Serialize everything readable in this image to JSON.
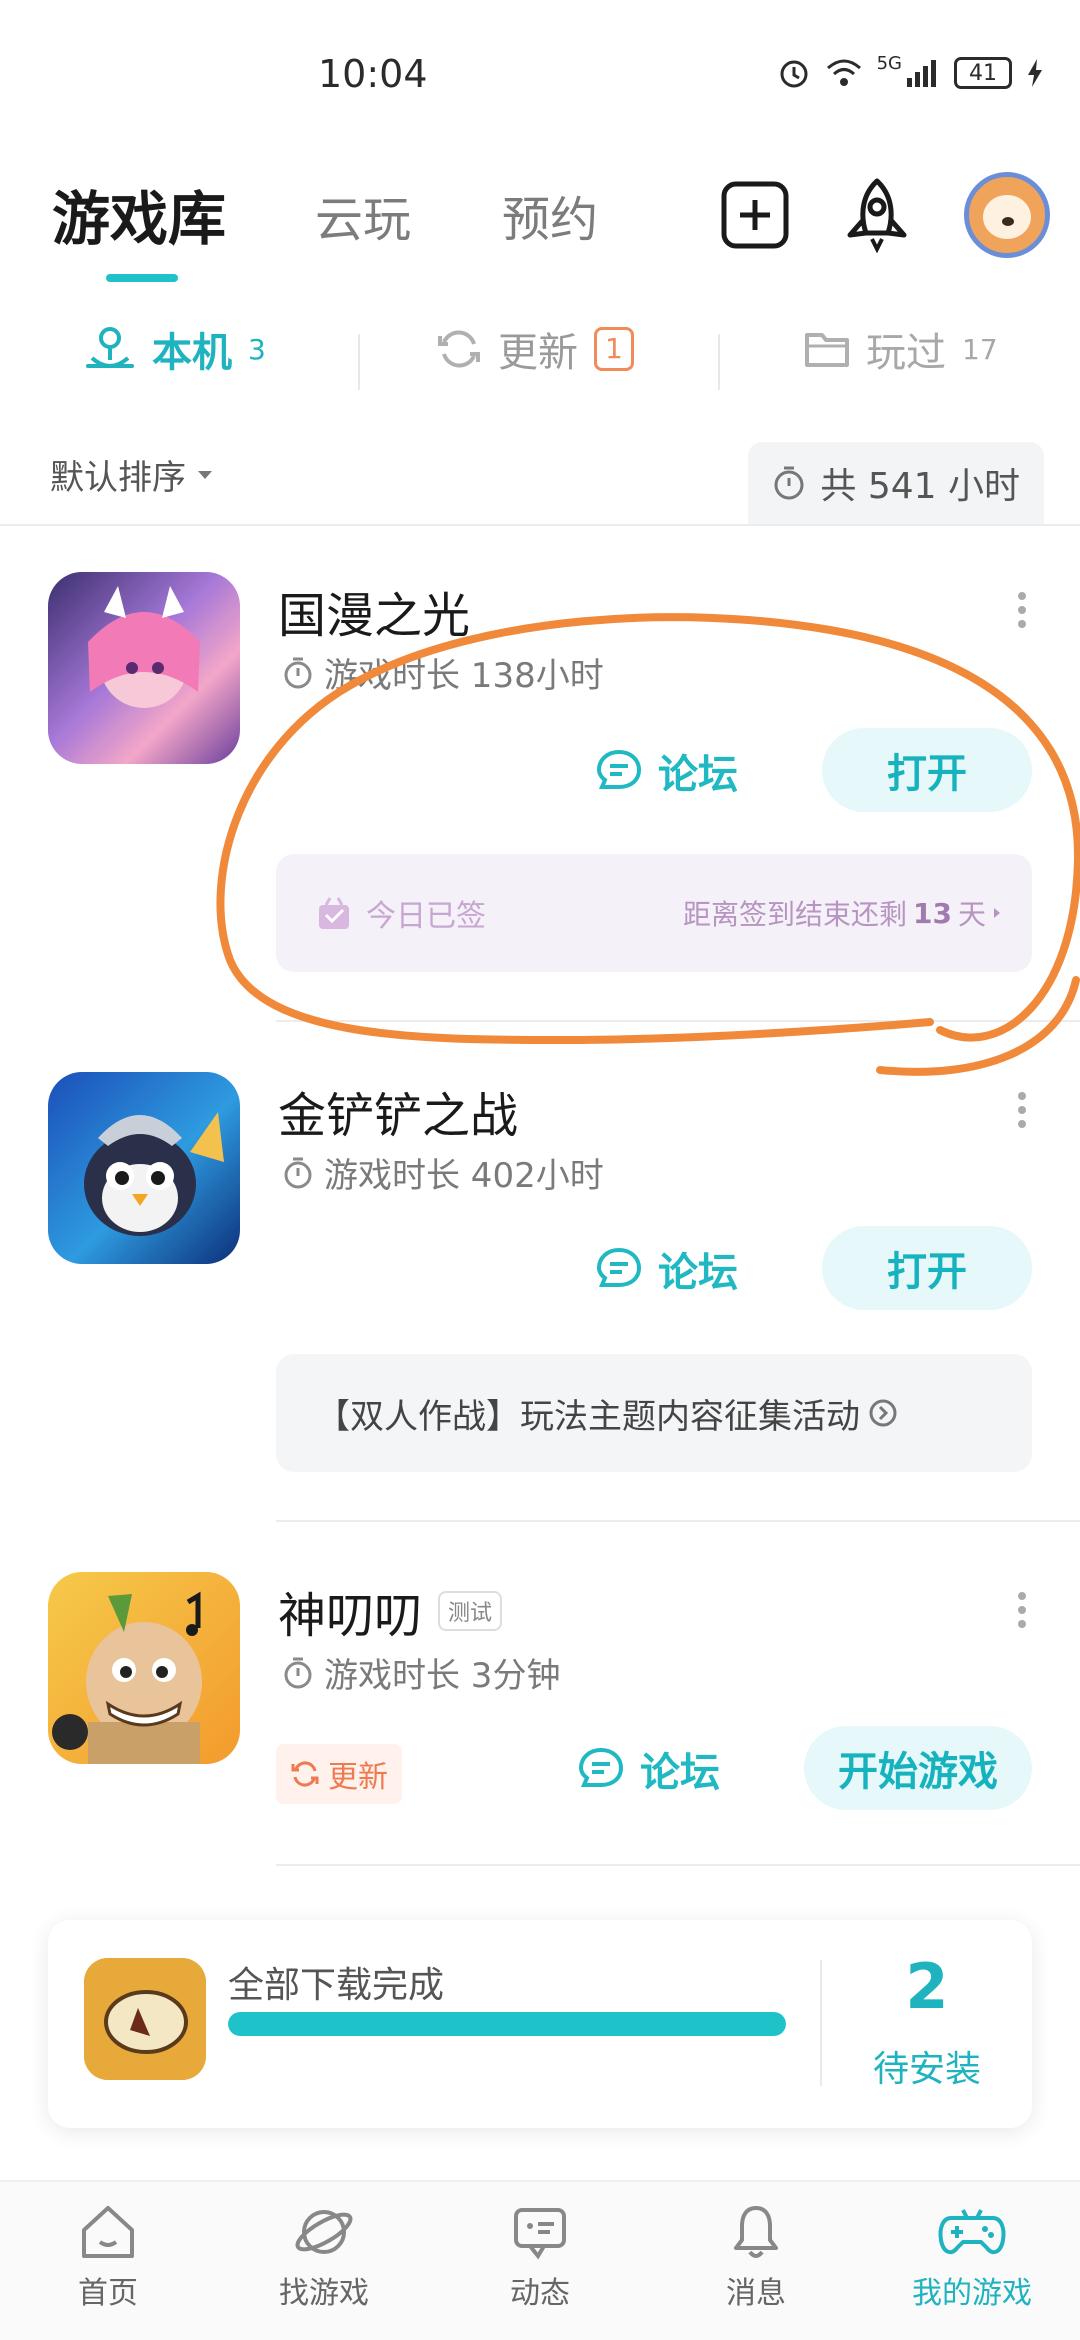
{
  "status_bar": {
    "time": "10:04",
    "battery": "41",
    "network": "5G"
  },
  "top_nav": {
    "tabs": [
      "游戏库",
      "云玩",
      "预约"
    ],
    "active_tab": "游戏库",
    "icons": [
      "add-icon",
      "rocket-icon",
      "avatar"
    ]
  },
  "sub_tabs": [
    {
      "label": "本机",
      "count": "3",
      "icon": "local-device-icon",
      "active": true
    },
    {
      "label": "更新",
      "count": "1",
      "icon": "refresh-icon",
      "active": false
    },
    {
      "label": "玩过",
      "count": "17",
      "icon": "folder-icon",
      "active": false
    }
  ],
  "sort": {
    "label": "默认排序",
    "total_time": "共 541 小时"
  },
  "games": [
    {
      "title": "国漫之光",
      "play_time": "游戏时长 138小时",
      "forum_label": "论坛",
      "action_label": "打开",
      "checkin_label": "今日已签",
      "checkin_remaining_prefix": "距离签到结束还剩",
      "checkin_days": "13",
      "checkin_remaining_suffix": "天"
    },
    {
      "title": "金铲铲之战",
      "play_time": "游戏时长 402小时",
      "forum_label": "论坛",
      "action_label": "打开",
      "event_label": "【双人作战】玩法主题内容征集活动"
    },
    {
      "title": "神叨叨",
      "tag": "测试",
      "play_time": "游戏时长 3分钟",
      "update_label": "更新",
      "forum_label": "论坛",
      "action_label": "开始游戏"
    }
  ],
  "download": {
    "label": "全部下载完成",
    "progress": 1.0,
    "pending_count": "2",
    "pending_label": "待安装"
  },
  "bottom_nav": [
    {
      "label": "首页",
      "icon": "home-icon",
      "active": false
    },
    {
      "label": "找游戏",
      "icon": "planet-icon",
      "active": false
    },
    {
      "label": "动态",
      "icon": "chat-card-icon",
      "active": false
    },
    {
      "label": "消息",
      "icon": "bell-icon",
      "active": false
    },
    {
      "label": "我的游戏",
      "icon": "gamepad-icon",
      "active": true
    }
  ],
  "colors": {
    "accent": "#1fb3bf",
    "annotation": "#f0893a",
    "update": "#f07a4f"
  }
}
